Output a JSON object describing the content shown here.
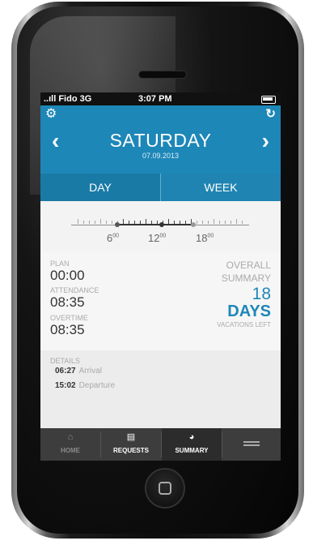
{
  "status_bar": {
    "carrier": "..ıll Fido 3G",
    "time": "3:07 PM"
  },
  "header": {
    "day": "SATURDAY",
    "date": "07.09.2013",
    "prev_icon": "chevron-left-icon",
    "next_icon": "chevron-right-icon",
    "settings_icon": "gear-icon",
    "refresh_icon": "refresh-icon"
  },
  "tabs": {
    "day": "DAY",
    "week": "WEEK"
  },
  "timeline": {
    "labels": [
      {
        "h": "6",
        "m": "00"
      },
      {
        "h": "12",
        "m": "00"
      },
      {
        "h": "18",
        "m": "00"
      }
    ]
  },
  "plan": {
    "label": "PLAN",
    "value": "00:00"
  },
  "attendance": {
    "label": "ATTENDANCE",
    "value": "08:35"
  },
  "overtime": {
    "label": "OVERTIME",
    "value": "08:35"
  },
  "summary": {
    "line1": "OVERALL",
    "line2": "SUMMARY",
    "number": "18",
    "unit": "DAYS",
    "sub": "VACATIONS LEFT"
  },
  "details": {
    "label": "DETAILS",
    "entries": [
      {
        "time": "06:27",
        "desc": "Arrival"
      },
      {
        "time": "15:02",
        "desc": "Departure"
      }
    ]
  },
  "tabbar": {
    "home": "HOME",
    "requests": "REQUESTS",
    "summary": "SUMMARY"
  },
  "colors": {
    "accent": "#1d87b8",
    "tabbar": "#3d3d3d"
  }
}
